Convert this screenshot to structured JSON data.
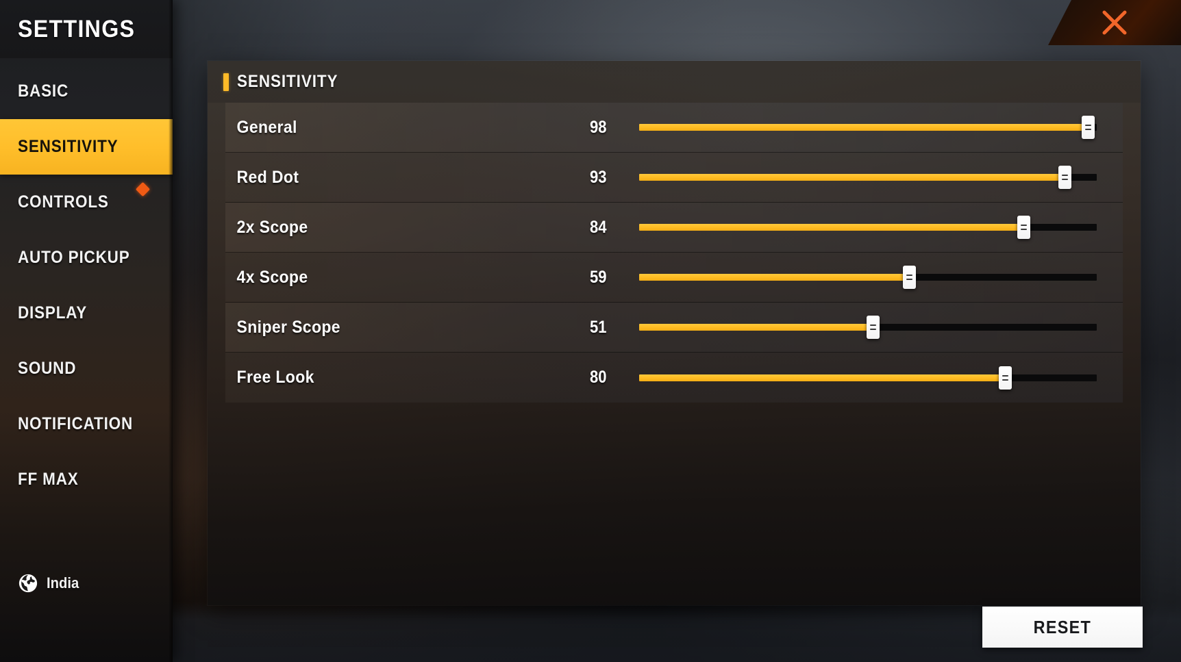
{
  "window": {
    "title": "SETTINGS",
    "close_icon": "close-x-icon"
  },
  "colors": {
    "accent_yellow": "#ffbe2a",
    "badge_orange": "#f05a14",
    "close_x": "#f2662a",
    "panel_dark": "#2a2520",
    "track_dark": "#0a0a0b",
    "thumb_white": "#ffffff"
  },
  "sidebar": {
    "items": [
      {
        "label": "BASIC",
        "active": false,
        "badge": false
      },
      {
        "label": "SENSITIVITY",
        "active": true,
        "badge": false
      },
      {
        "label": "CONTROLS",
        "active": false,
        "badge": true
      },
      {
        "label": "AUTO PICKUP",
        "active": false,
        "badge": false
      },
      {
        "label": "DISPLAY",
        "active": false,
        "badge": false
      },
      {
        "label": "SOUND",
        "active": false,
        "badge": false
      },
      {
        "label": "NOTIFICATION",
        "active": false,
        "badge": false
      },
      {
        "label": "FF MAX",
        "active": false,
        "badge": false
      }
    ],
    "locale": {
      "icon": "globe-icon",
      "label": "India"
    }
  },
  "main": {
    "section_title": "SENSITIVITY",
    "slider_min": 0,
    "slider_max": 100,
    "rows": [
      {
        "label": "General",
        "value": "98",
        "percent": 98
      },
      {
        "label": "Red Dot",
        "value": "93",
        "percent": 93
      },
      {
        "label": "2x Scope",
        "value": "84",
        "percent": 84
      },
      {
        "label": "4x Scope",
        "value": "59",
        "percent": 59
      },
      {
        "label": "Sniper Scope",
        "value": "51",
        "percent": 51
      },
      {
        "label": "Free Look",
        "value": "80",
        "percent": 80
      }
    ]
  },
  "footer": {
    "reset_label": "RESET"
  }
}
